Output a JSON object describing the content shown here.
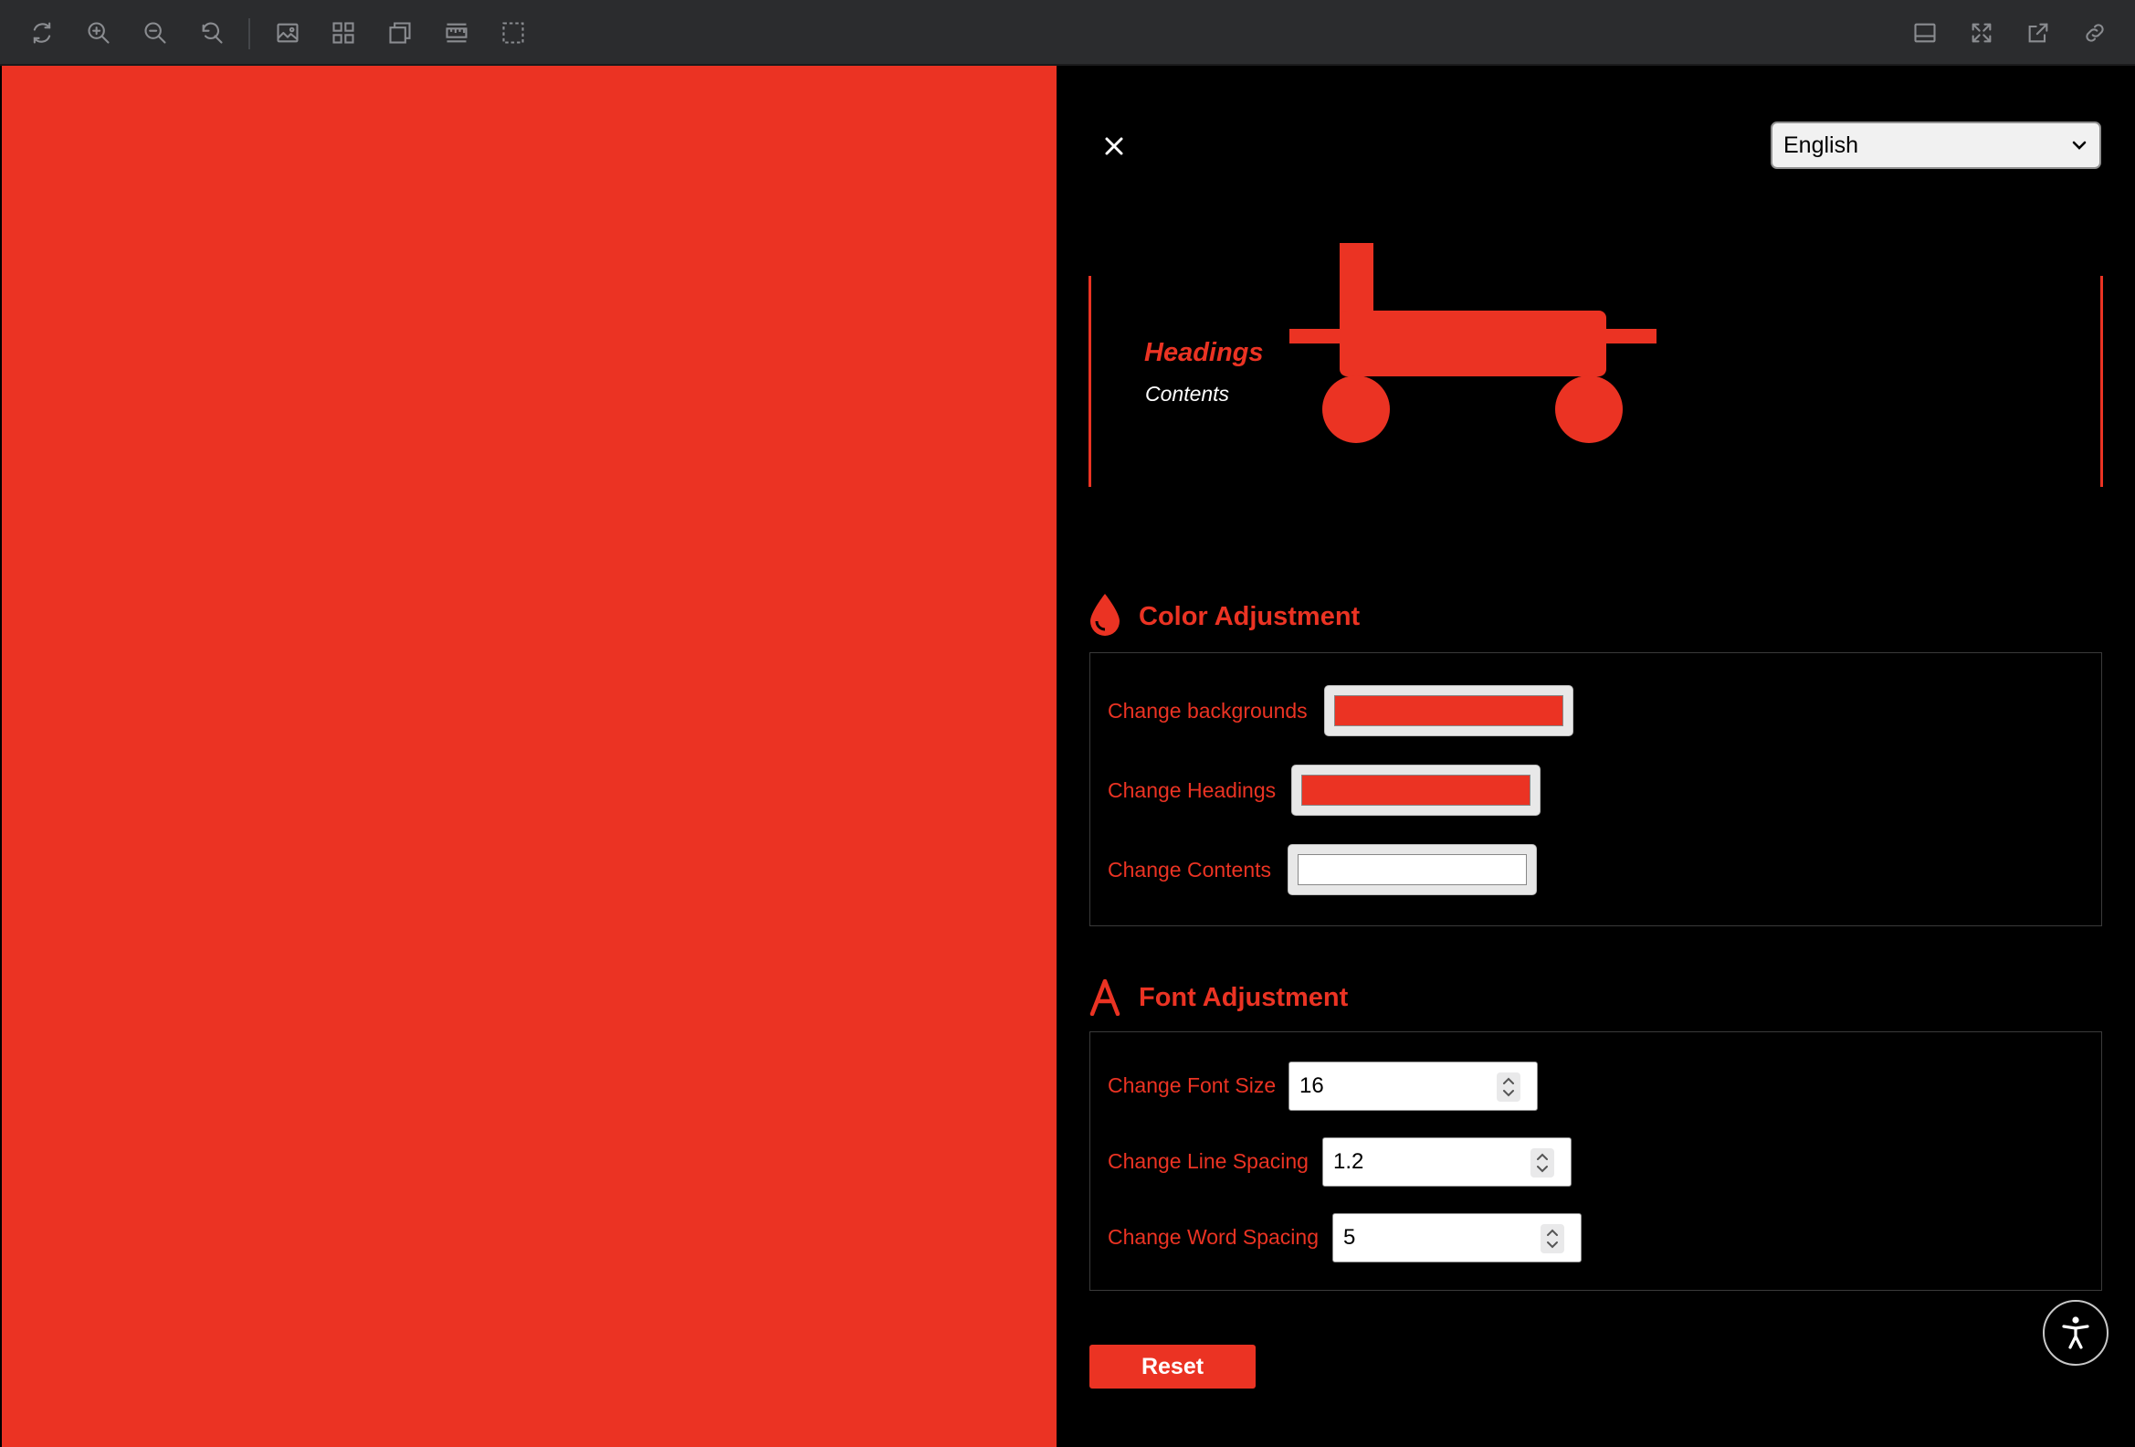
{
  "toolbar": {
    "left_icons": [
      "rotate-icon",
      "zoom-in-icon",
      "zoom-out-icon",
      "reset-zoom-icon",
      "image-icon",
      "grid-icon",
      "layers-icon",
      "ruler-icon",
      "select-area-icon"
    ],
    "right_icons": [
      "panel-icon",
      "fullscreen-icon",
      "open-external-icon",
      "link-icon"
    ]
  },
  "colors": {
    "accent": "#eb3323",
    "background": "#eb3323",
    "headings": "#eb3323",
    "contents": "#ffffff",
    "panel_bg": "#000000"
  },
  "panel": {
    "language_selected": "English",
    "preview": {
      "heading": "Headings",
      "content": "Contents"
    },
    "color_section": {
      "title": "Color Adjustment",
      "icon": "droplet-icon",
      "rows": [
        {
          "label": "Change backgrounds",
          "value": "#eb3323"
        },
        {
          "label": "Change Headings",
          "value": "#eb3323"
        },
        {
          "label": "Change Contents",
          "value": "#ffffff"
        }
      ]
    },
    "font_section": {
      "title": "Font Adjustment",
      "icon": "font-icon",
      "rows": [
        {
          "label": "Change Font Size",
          "value": "16"
        },
        {
          "label": "Change Line Spacing",
          "value": "1.2"
        },
        {
          "label": "Change Word Spacing",
          "value": "5"
        }
      ]
    },
    "reset_label": "Reset"
  },
  "accessibility_button_icon": "accessibility-icon"
}
